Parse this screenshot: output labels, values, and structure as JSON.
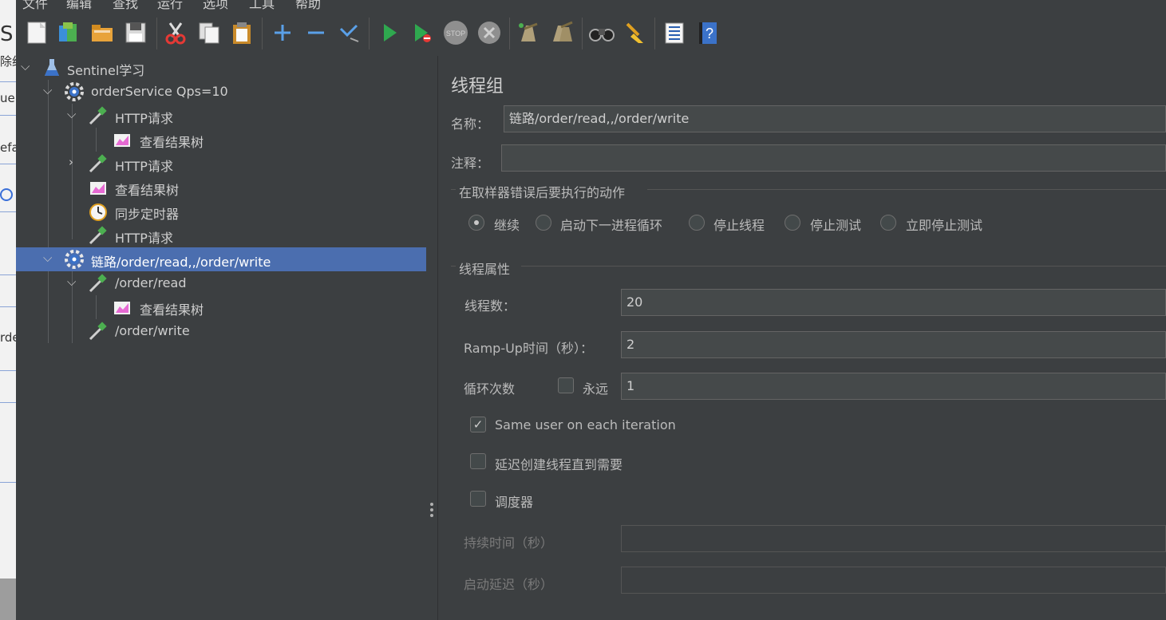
{
  "menubar": {
    "items": [
      "文件",
      "编辑",
      "查找",
      "运行",
      "选项",
      "工具",
      "帮助"
    ]
  },
  "sliver": {
    "items": [
      "S",
      "除约",
      "ue",
      "efa",
      "rde"
    ]
  },
  "toolbar": {
    "buttons": [
      {
        "name": "new-icon"
      },
      {
        "name": "templates-icon"
      },
      {
        "name": "open-icon"
      },
      {
        "name": "save-icon"
      },
      {
        "name": "cut-icon"
      },
      {
        "name": "copy-icon"
      },
      {
        "name": "paste-icon"
      },
      {
        "name": "expand-icon"
      },
      {
        "name": "collapse-icon"
      },
      {
        "name": "toggle-icon"
      },
      {
        "name": "start-icon"
      },
      {
        "name": "start-no-pauses-icon"
      },
      {
        "name": "stop-icon"
      },
      {
        "name": "shutdown-icon"
      },
      {
        "name": "clear-icon"
      },
      {
        "name": "clear-all-icon"
      },
      {
        "name": "search-icon"
      },
      {
        "name": "reset-search-icon"
      },
      {
        "name": "function-helper-icon"
      },
      {
        "name": "help-icon"
      }
    ],
    "stop_text": "STOP"
  },
  "tree": {
    "nodes": [
      {
        "label": "Sentinel学习",
        "icon": "test-plan-icon",
        "arrow": "down"
      },
      {
        "label": "orderService Qps=10",
        "icon": "thread-group-icon",
        "arrow": "down"
      },
      {
        "label": "HTTP请求",
        "icon": "sampler-icon",
        "arrow": "down"
      },
      {
        "label": "查看结果树",
        "icon": "listener-icon",
        "arrow": ""
      },
      {
        "label": "HTTP请求",
        "icon": "sampler-icon",
        "arrow": "right"
      },
      {
        "label": "查看结果树",
        "icon": "listener-icon",
        "arrow": ""
      },
      {
        "label": "同步定时器",
        "icon": "timer-icon",
        "arrow": ""
      },
      {
        "label": "HTTP请求",
        "icon": "sampler-icon",
        "arrow": ""
      },
      {
        "label": "链路/order/read,,/order/write",
        "icon": "thread-group-icon",
        "arrow": "down",
        "selected": true
      },
      {
        "label": "/order/read",
        "icon": "sampler-icon",
        "arrow": "down"
      },
      {
        "label": "查看结果树",
        "icon": "listener-icon",
        "arrow": ""
      },
      {
        "label": "/order/write",
        "icon": "sampler-icon",
        "arrow": ""
      }
    ]
  },
  "panel": {
    "title": "线程组",
    "name_label": "名称：",
    "name_value": "链路/order/read,,/order/write",
    "comment_label": "注释：",
    "comment_value": "",
    "error_group_title": "在取样器错误后要执行的动作",
    "error_options": [
      {
        "label": "继续",
        "selected": true
      },
      {
        "label": "启动下一进程循环",
        "selected": false
      },
      {
        "label": "停止线程",
        "selected": false
      },
      {
        "label": "停止测试",
        "selected": false
      },
      {
        "label": "立即停止测试",
        "selected": false
      }
    ],
    "thread_group_title": "线程属性",
    "threads_label": "线程数：",
    "threads_value": "20",
    "rampup_label": "Ramp-Up时间（秒）：",
    "rampup_value": "2",
    "loop_label": "循环次数",
    "forever_label": "永远",
    "forever_checked": false,
    "loop_value": "1",
    "same_user_label": "Same user on each iteration",
    "same_user_checked": true,
    "delay_label": "延迟创建线程直到需要",
    "delay_checked": false,
    "scheduler_label": "调度器",
    "scheduler_checked": false,
    "duration_label": "持续时间（秒）",
    "duration_value": "",
    "startup_delay_label": "启动延迟（秒）",
    "startup_delay_value": ""
  },
  "colors": {
    "background": "#3c3f41",
    "selection": "#4b6eaf",
    "field": "#45494a",
    "run_green": "#2fa84f"
  }
}
